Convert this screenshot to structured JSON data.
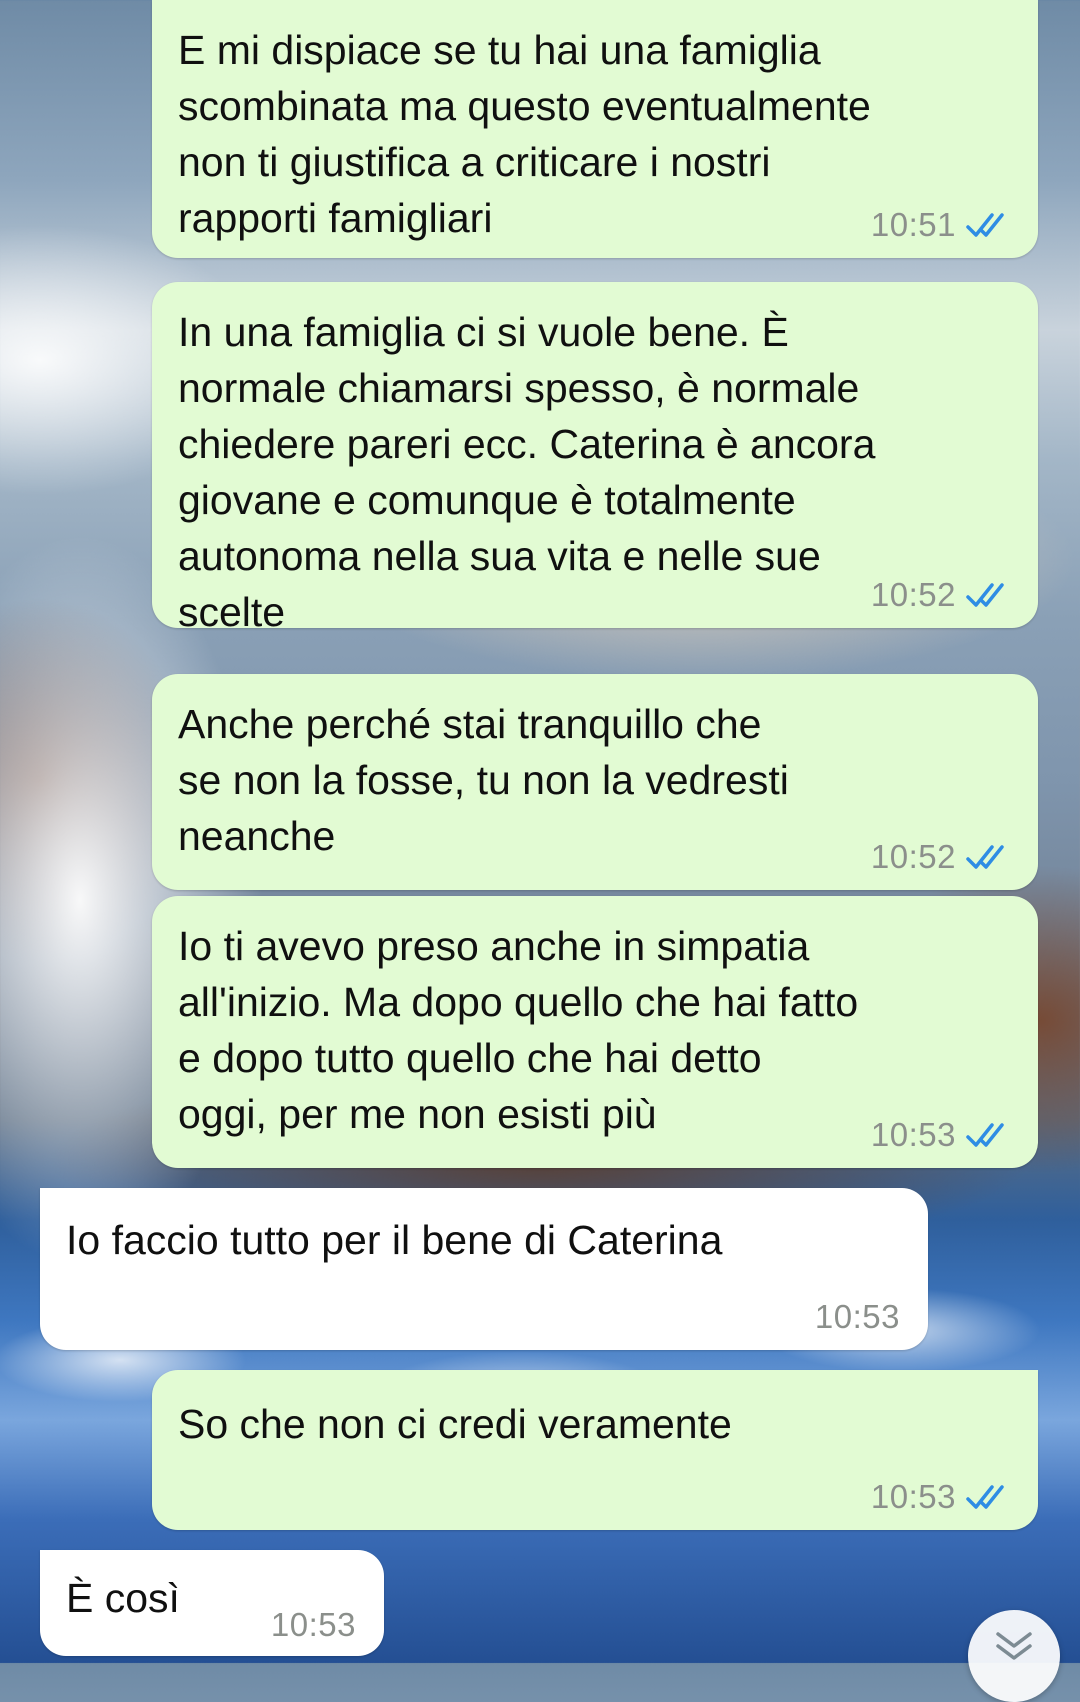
{
  "messages": [
    {
      "direction": "outgoing",
      "text": "E mi dispiace se tu hai una famiglia\nscombinata ma questo eventualmente\nnon ti giustifica a criticare i nostri\nrapporti famigliari",
      "time": "10:51",
      "status": "read"
    },
    {
      "direction": "outgoing",
      "text": "In una famiglia ci si vuole bene. È\nnormale chiamarsi spesso, è normale\nchiedere pareri ecc. Caterina è ancora\ngiovane e comunque è totalmente\nautonoma nella sua vita e nelle sue\nscelte",
      "time": "10:52",
      "status": "read"
    },
    {
      "direction": "outgoing",
      "text": "Anche perché stai tranquillo che\nse non la fosse, tu non la vedresti\nneanche",
      "time": "10:52",
      "status": "read"
    },
    {
      "direction": "outgoing",
      "text": "Io ti avevo preso anche in simpatia\nall'inizio. Ma dopo quello che hai fatto\ne dopo tutto quello che hai detto\noggi, per me non esisti più",
      "time": "10:53",
      "status": "read"
    },
    {
      "direction": "incoming",
      "text": "Io faccio tutto per il bene di Caterina",
      "time": "10:53"
    },
    {
      "direction": "outgoing",
      "text": "So che non ci credi veramente",
      "time": "10:53",
      "status": "read"
    },
    {
      "direction": "incoming",
      "text": "È così",
      "time": "10:53"
    }
  ],
  "icons": {
    "read_receipt": "double-check-icon",
    "scroll_down": "chevron-down-double-icon"
  },
  "colors": {
    "outgoing_bubble": "#e2fbd3",
    "incoming_bubble": "#ffffff",
    "read_check": "#2f8de4",
    "time_text": "#8b8f8b"
  }
}
